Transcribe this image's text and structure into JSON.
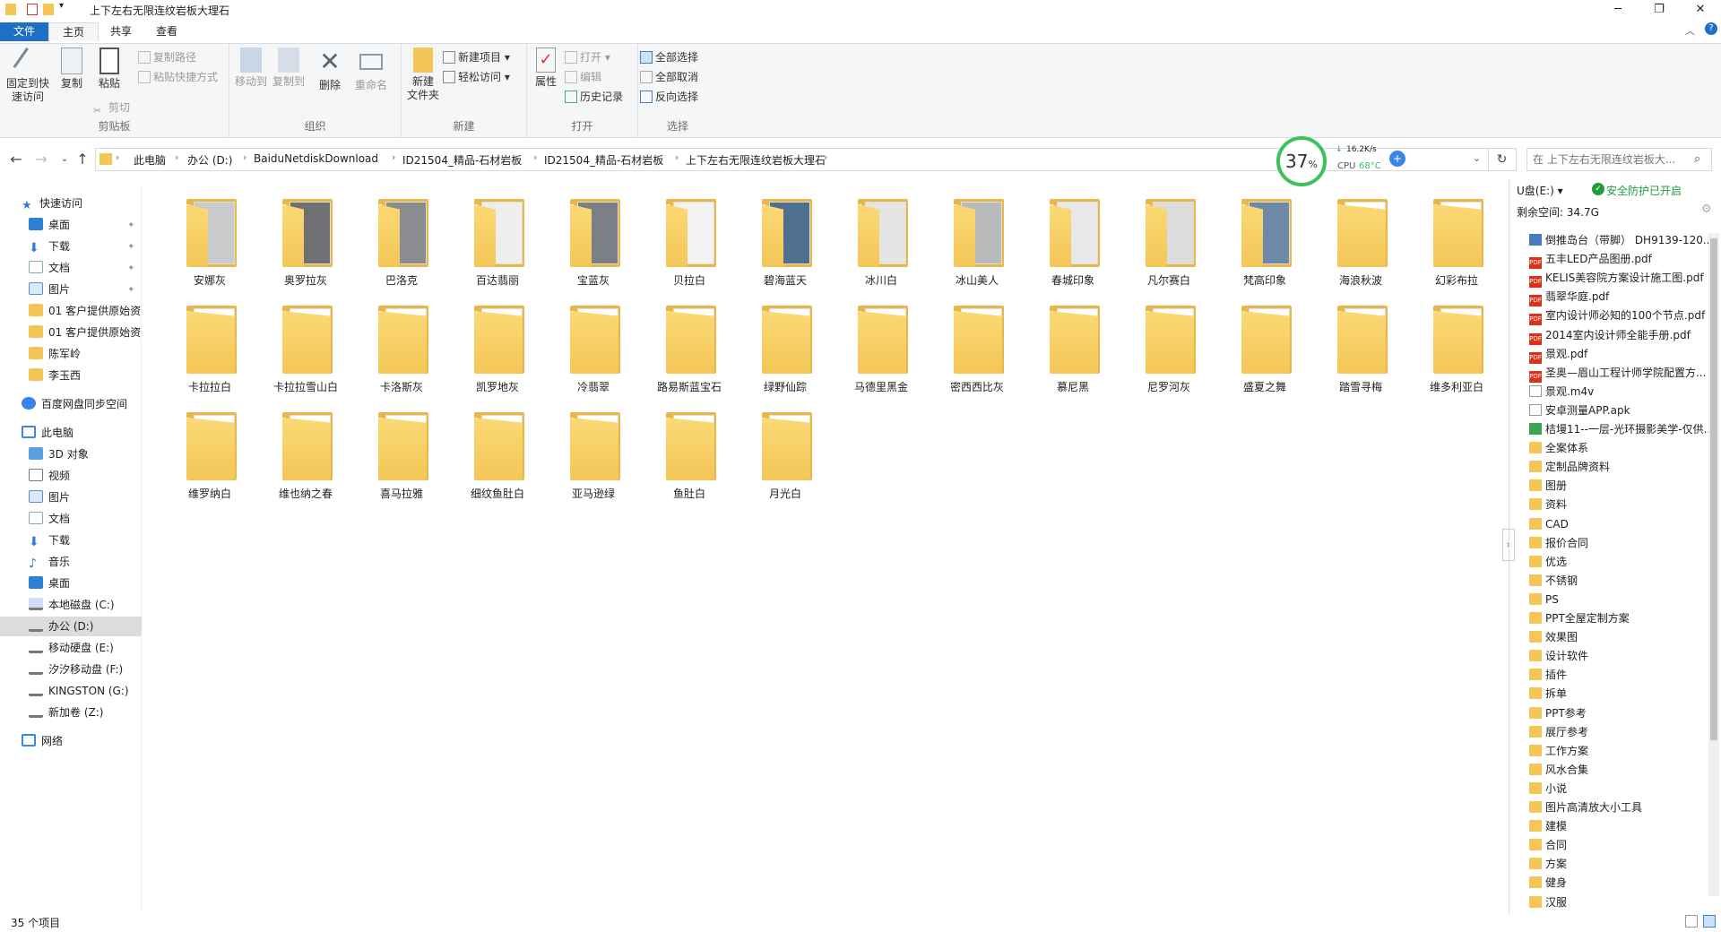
{
  "window": {
    "title": "上下左右无限连纹岩板大理石"
  },
  "tabs": {
    "file": "文件",
    "home": "主页",
    "share": "共享",
    "view": "查看"
  },
  "ribbon": {
    "clipboard": {
      "label": "剪贴板",
      "pin": "固定到快\n速访问",
      "copy": "复制",
      "paste": "粘贴",
      "copy_path": "复制路径",
      "paste_shortcut": "粘贴快捷方式",
      "cut": "剪切"
    },
    "organize": {
      "label": "组织",
      "move_to": "移动到",
      "copy_to": "复制到",
      "delete": "删除",
      "rename": "重命名"
    },
    "new": {
      "label": "新建",
      "new_folder": "新建\n文件夹",
      "new_item": "新建项目 ▾",
      "easy_access": "轻松访问 ▾"
    },
    "open": {
      "label": "打开",
      "properties": "属性",
      "open": "打开 ▾",
      "edit": "编辑",
      "history": "历史记录"
    },
    "select": {
      "label": "选择",
      "select_all": "全部选择",
      "select_none": "全部取消",
      "invert": "反向选择"
    }
  },
  "address": {
    "crumbs": [
      "此电脑",
      "办公 (D:)",
      "BaiduNetdiskDownload",
      "ID21504_精品-石材岩板",
      "ID21504_精品-石材岩板",
      "上下左右无限连纹岩板大理石"
    ]
  },
  "search": {
    "placeholder": "在 上下左右无限连纹岩板大..."
  },
  "speed": {
    "percent": "37",
    "unit": "%",
    "rate": "16.2K/s",
    "cpu_label": "CPU",
    "cpu_temp": "68°C"
  },
  "nav": {
    "quick_access": "快速访问",
    "quick_items": [
      "桌面",
      "下载",
      "文档",
      "图片",
      "01 客户提供原始资",
      "01 客户提供原始资",
      "陈军岭",
      "李玉西"
    ],
    "baidu": "百度网盘同步空间",
    "this_pc": "此电脑",
    "pc_items": [
      "3D 对象",
      "视频",
      "图片",
      "文档",
      "下载",
      "音乐",
      "桌面",
      "本地磁盘 (C:)",
      "办公 (D:)",
      "移动硬盘 (E:)",
      "汐汐移动盘 (F:)",
      "KINGSTON (G:)",
      "新加卷 (Z:)"
    ],
    "network": "网络"
  },
  "folders": [
    {
      "name": "安娜灰",
      "thumb": "#c9cacc"
    },
    {
      "name": "奥罗拉灰",
      "thumb": "#6f7073"
    },
    {
      "name": "巴洛克",
      "thumb": "#8a8c8f"
    },
    {
      "name": "百达翡丽",
      "thumb": "#eeeeee"
    },
    {
      "name": "宝蓝灰",
      "thumb": "#7c7f85"
    },
    {
      "name": "贝拉白",
      "thumb": "#f2f2f2"
    },
    {
      "name": "碧海蓝天",
      "thumb": "#4f6f8f"
    },
    {
      "name": "冰川白",
      "thumb": "#e4e4e4"
    },
    {
      "name": "冰山美人",
      "thumb": "#b8babc"
    },
    {
      "name": "春城印象",
      "thumb": "#e8e8ea"
    },
    {
      "name": "凡尔赛白",
      "thumb": "#dcdcdc"
    },
    {
      "name": "梵高印象",
      "thumb": "#6c8aa8"
    },
    {
      "name": "海浪秋波",
      "thumb": ""
    },
    {
      "name": "幻彩布拉",
      "thumb": ""
    },
    {
      "name": "卡拉拉白",
      "thumb": ""
    },
    {
      "name": "卡拉拉雪山白",
      "thumb": ""
    },
    {
      "name": "卡洛斯灰",
      "thumb": ""
    },
    {
      "name": "凯罗地灰",
      "thumb": ""
    },
    {
      "name": "冷翡翠",
      "thumb": ""
    },
    {
      "name": "路易斯蓝宝石",
      "thumb": ""
    },
    {
      "name": "绿野仙踪",
      "thumb": ""
    },
    {
      "name": "马德里黑金",
      "thumb": ""
    },
    {
      "name": "密西西比灰",
      "thumb": ""
    },
    {
      "name": "慕尼黑",
      "thumb": ""
    },
    {
      "name": "尼罗河灰",
      "thumb": ""
    },
    {
      "name": "盛夏之舞",
      "thumb": ""
    },
    {
      "name": "踏雪寻梅",
      "thumb": ""
    },
    {
      "name": "维多利亚白",
      "thumb": ""
    },
    {
      "name": "维罗纳白",
      "thumb": ""
    },
    {
      "name": "维也纳之春",
      "thumb": ""
    },
    {
      "name": "喜马拉雅",
      "thumb": ""
    },
    {
      "name": "细纹鱼肚白",
      "thumb": ""
    },
    {
      "name": "亚马逊绿",
      "thumb": ""
    },
    {
      "name": "鱼肚白",
      "thumb": ""
    },
    {
      "name": "月光白",
      "thumb": ""
    }
  ],
  "right_pane": {
    "drive": "U盘(E:) ▾",
    "safe": "安全防护已开启",
    "free": "剩余空间: 34.7G",
    "items": [
      {
        "name": "倒推岛台（带脚） DH9139-120...",
        "type": "img"
      },
      {
        "name": "五丰LED产品图册.pdf",
        "type": "pdf"
      },
      {
        "name": "KELIS美容院方案设计施工图.pdf",
        "type": "pdf"
      },
      {
        "name": "翡翠华庭.pdf",
        "type": "pdf"
      },
      {
        "name": "室内设计师必知的100个节点.pdf",
        "type": "pdf"
      },
      {
        "name": "2014室内设计师全能手册.pdf",
        "type": "pdf"
      },
      {
        "name": "景观.pdf",
        "type": "pdf"
      },
      {
        "name": "圣奥—眉山工程计师学院配置方...",
        "type": "pdf"
      },
      {
        "name": "景观.m4v",
        "type": "file"
      },
      {
        "name": "安卓测量APP.apk",
        "type": "file"
      },
      {
        "name": "桔墁11--一层-光环摄影美学-仅供...",
        "type": "ppt"
      },
      {
        "name": "全案体系",
        "type": "folder"
      },
      {
        "name": "定制品牌资料",
        "type": "folder"
      },
      {
        "name": "图册",
        "type": "folder"
      },
      {
        "name": "资料",
        "type": "folder"
      },
      {
        "name": "CAD",
        "type": "folder"
      },
      {
        "name": "报价合同",
        "type": "folder"
      },
      {
        "name": "优选",
        "type": "folder"
      },
      {
        "name": "不锈钢",
        "type": "folder"
      },
      {
        "name": "PS",
        "type": "folder"
      },
      {
        "name": "PPT全屋定制方案",
        "type": "folder"
      },
      {
        "name": "效果图",
        "type": "folder"
      },
      {
        "name": "设计软件",
        "type": "folder"
      },
      {
        "name": "插件",
        "type": "folder"
      },
      {
        "name": "拆单",
        "type": "folder"
      },
      {
        "name": "PPT参考",
        "type": "folder"
      },
      {
        "name": "展厅参考",
        "type": "folder"
      },
      {
        "name": "工作方案",
        "type": "folder"
      },
      {
        "name": "风水合集",
        "type": "folder"
      },
      {
        "name": "小说",
        "type": "folder"
      },
      {
        "name": "图片高清放大小工具",
        "type": "folder"
      },
      {
        "name": "建模",
        "type": "folder"
      },
      {
        "name": "合同",
        "type": "folder"
      },
      {
        "name": "方案",
        "type": "folder"
      },
      {
        "name": "健身",
        "type": "folder"
      },
      {
        "name": "汉服",
        "type": "folder"
      }
    ]
  },
  "status": {
    "count": "35 个项目"
  },
  "colors": {
    "accent": "#1e6fc6",
    "folder": "#f3c657",
    "gauge": "#3cc15d",
    "safe": "#1f9d3d"
  }
}
